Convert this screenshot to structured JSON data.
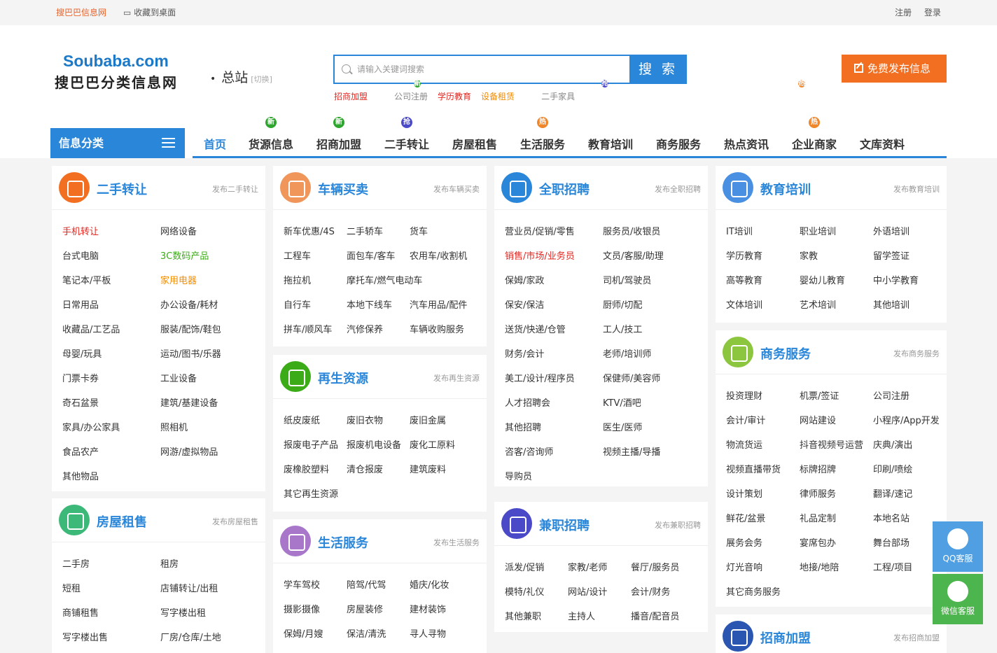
{
  "topbar": {
    "site": "搜巴巴信息网",
    "bookmark": "收藏到桌面",
    "register": "注册",
    "login": "登录"
  },
  "logo": {
    "en": "Soubaba.com",
    "cn": "搜巴巴分类信息网"
  },
  "station": {
    "name": "总站",
    "switch": "[切换]"
  },
  "search": {
    "placeholder": "请输入关键词搜索",
    "button": "搜 索"
  },
  "hotwords": [
    {
      "label": "招商加盟",
      "color": "#e3261f",
      "badge": "新",
      "badge_type": "new"
    },
    {
      "label": "公司注册",
      "color": "#888888",
      "badge": "",
      "badge_type": ""
    },
    {
      "label": "学历教育",
      "color": "#e3261f",
      "badge": "",
      "badge_type": ""
    },
    {
      "label": "设备租赁",
      "color": "#f28c00",
      "badge": "抢",
      "badge_type": "grab"
    },
    {
      "label": "二手家具",
      "color": "#888888",
      "badge": "热",
      "badge_type": "hot"
    }
  ],
  "publish": {
    "label": "免费发布信息"
  },
  "category_box": {
    "label": "信息分类"
  },
  "nav": [
    {
      "label": "首页",
      "active": true,
      "badge": "",
      "badge_type": ""
    },
    {
      "label": "货源信息",
      "active": false,
      "badge": "新",
      "badge_type": "new"
    },
    {
      "label": "招商加盟",
      "active": false,
      "badge": "新",
      "badge_type": "new"
    },
    {
      "label": "二手转让",
      "active": false,
      "badge": "抢",
      "badge_type": "grab"
    },
    {
      "label": "房屋租售",
      "active": false,
      "badge": "",
      "badge_type": ""
    },
    {
      "label": "生活服务",
      "active": false,
      "badge": "热",
      "badge_type": "hot"
    },
    {
      "label": "教育培训",
      "active": false,
      "badge": "",
      "badge_type": ""
    },
    {
      "label": "商务服务",
      "active": false,
      "badge": "",
      "badge_type": ""
    },
    {
      "label": "热点资讯",
      "active": false,
      "badge": "",
      "badge_type": ""
    },
    {
      "label": "企业商家",
      "active": false,
      "badge": "热",
      "badge_type": "hot"
    },
    {
      "label": "文库资料",
      "active": false,
      "badge": "",
      "badge_type": ""
    }
  ],
  "panels": [
    {
      "title": "二手转让",
      "publish": "发布二手转让",
      "icon_color": "#f26f21",
      "icon": "cart-icon",
      "items": [
        {
          "label": "手机转让",
          "style": "red"
        },
        {
          "label": "网络设备",
          "style": ""
        },
        {
          "label": "台式电脑",
          "style": ""
        },
        {
          "label": "3C数码产品",
          "style": "green"
        },
        {
          "label": "笔记本/平板",
          "style": ""
        },
        {
          "label": "家用电器",
          "style": "orange"
        },
        {
          "label": "日常用品",
          "style": ""
        },
        {
          "label": "办公设备/耗材",
          "style": ""
        },
        {
          "label": "收藏品/工艺品",
          "style": ""
        },
        {
          "label": "服装/配饰/鞋包",
          "style": ""
        },
        {
          "label": "母婴/玩具",
          "style": ""
        },
        {
          "label": "运动/图书/乐器",
          "style": ""
        },
        {
          "label": "门票卡券",
          "style": ""
        },
        {
          "label": "工业设备",
          "style": ""
        },
        {
          "label": "奇石盆景",
          "style": ""
        },
        {
          "label": "建筑/基建设备",
          "style": ""
        },
        {
          "label": "家具/办公家具",
          "style": ""
        },
        {
          "label": "照相机",
          "style": ""
        },
        {
          "label": "食品农产",
          "style": ""
        },
        {
          "label": "网游/虚拟物品",
          "style": ""
        },
        {
          "label": "其他物品",
          "style": ""
        }
      ]
    },
    {
      "title": "房屋租售",
      "publish": "发布房屋租售",
      "icon_color": "#3cb878",
      "icon": "house-icon",
      "items": [
        {
          "label": "二手房",
          "style": ""
        },
        {
          "label": "租房",
          "style": ""
        },
        {
          "label": "短租",
          "style": ""
        },
        {
          "label": "店铺转让/出租",
          "style": ""
        },
        {
          "label": "商铺租售",
          "style": ""
        },
        {
          "label": "写字楼出租",
          "style": ""
        },
        {
          "label": "写字楼出售",
          "style": ""
        },
        {
          "label": "厂房/仓库/土地",
          "style": ""
        }
      ]
    },
    {
      "title": "车辆买卖",
      "publish": "发布车辆买卖",
      "icon_color": "#f0965a",
      "icon": "car-icon",
      "items": [
        {
          "label": "新车优惠/4S",
          "style": ""
        },
        {
          "label": "二手轿车",
          "style": ""
        },
        {
          "label": "货车",
          "style": ""
        },
        {
          "label": "工程车",
          "style": ""
        },
        {
          "label": "面包车/客车",
          "style": ""
        },
        {
          "label": "农用车/收割机",
          "style": ""
        },
        {
          "label": "拖拉机",
          "style": ""
        },
        {
          "label": "摩托车/燃气电动车",
          "style": ""
        },
        {
          "label": "",
          "style": ""
        },
        {
          "label": "自行车",
          "style": ""
        },
        {
          "label": "本地下线车",
          "style": ""
        },
        {
          "label": "汽车用品/配件",
          "style": ""
        },
        {
          "label": "拼车/顺风车",
          "style": ""
        },
        {
          "label": "汽修保养",
          "style": ""
        },
        {
          "label": "车辆收购服务",
          "style": ""
        }
      ]
    },
    {
      "title": "再生资源",
      "publish": "发布再生资源",
      "icon_color": "#3cab18",
      "icon": "recycle-icon",
      "items": [
        {
          "label": "纸皮废纸",
          "style": ""
        },
        {
          "label": "废旧衣物",
          "style": ""
        },
        {
          "label": "废旧金属",
          "style": ""
        },
        {
          "label": "报废电子产品",
          "style": ""
        },
        {
          "label": "报废机电设备",
          "style": ""
        },
        {
          "label": "废化工原料",
          "style": ""
        },
        {
          "label": "废橡胶塑料",
          "style": ""
        },
        {
          "label": "清仓报废",
          "style": ""
        },
        {
          "label": "建筑废料",
          "style": ""
        },
        {
          "label": "其它再生资源",
          "style": ""
        }
      ]
    },
    {
      "title": "生活服务",
      "publish": "发布生活服务",
      "icon_color": "#a877c9",
      "icon": "umbrella-icon",
      "items": [
        {
          "label": "学车驾校",
          "style": ""
        },
        {
          "label": "陪驾/代驾",
          "style": ""
        },
        {
          "label": "婚庆/化妆",
          "style": ""
        },
        {
          "label": "摄影摄像",
          "style": ""
        },
        {
          "label": "房屋装修",
          "style": ""
        },
        {
          "label": "建材装饰",
          "style": ""
        },
        {
          "label": "保姆/月嫂",
          "style": ""
        },
        {
          "label": "保洁/清洗",
          "style": ""
        },
        {
          "label": "寻人寻物",
          "style": ""
        }
      ]
    },
    {
      "title": "全职招聘",
      "publish": "发布全职招聘",
      "icon_color": "#2a86d9",
      "icon": "magnifier-icon",
      "items": [
        {
          "label": "营业员/促销/零售",
          "style": ""
        },
        {
          "label": "服务员/收银员",
          "style": ""
        },
        {
          "label": "销售/市场/业务员",
          "style": "red"
        },
        {
          "label": "文员/客服/助理",
          "style": ""
        },
        {
          "label": "保姆/家政",
          "style": ""
        },
        {
          "label": "司机/驾驶员",
          "style": ""
        },
        {
          "label": "保安/保洁",
          "style": ""
        },
        {
          "label": "厨师/切配",
          "style": ""
        },
        {
          "label": "送货/快递/仓管",
          "style": ""
        },
        {
          "label": "工人/技工",
          "style": ""
        },
        {
          "label": "财务/会计",
          "style": ""
        },
        {
          "label": "老师/培训师",
          "style": ""
        },
        {
          "label": "美工/设计/程序员",
          "style": ""
        },
        {
          "label": "保健师/美容师",
          "style": ""
        },
        {
          "label": "人才招聘会",
          "style": ""
        },
        {
          "label": "KTV/酒吧",
          "style": ""
        },
        {
          "label": "其他招聘",
          "style": ""
        },
        {
          "label": "医生/医师",
          "style": ""
        },
        {
          "label": "咨客/咨询师",
          "style": ""
        },
        {
          "label": "视频主播/导播",
          "style": ""
        },
        {
          "label": "导购员",
          "style": ""
        }
      ]
    },
    {
      "title": "兼职招聘",
      "publish": "发布兼职招聘",
      "icon_color": "#4a4ac8",
      "icon": "clock-icon",
      "items": [
        {
          "label": "派发/促销",
          "style": ""
        },
        {
          "label": "家教/老师",
          "style": ""
        },
        {
          "label": "餐厅/服务员",
          "style": ""
        },
        {
          "label": "模特/礼仪",
          "style": ""
        },
        {
          "label": "网站/设计",
          "style": ""
        },
        {
          "label": "会计/财务",
          "style": ""
        },
        {
          "label": "其他兼职",
          "style": ""
        },
        {
          "label": "主持人",
          "style": ""
        },
        {
          "label": "播音/配音员",
          "style": ""
        }
      ]
    },
    {
      "title": "教育培训",
      "publish": "发布教育培训",
      "icon_color": "#4a90e2",
      "icon": "graduation-icon",
      "items": [
        {
          "label": "IT培训",
          "style": ""
        },
        {
          "label": "职业培训",
          "style": ""
        },
        {
          "label": "外语培训",
          "style": ""
        },
        {
          "label": "学历教育",
          "style": ""
        },
        {
          "label": "家教",
          "style": ""
        },
        {
          "label": "留学签证",
          "style": ""
        },
        {
          "label": "高等教育",
          "style": ""
        },
        {
          "label": "婴幼儿教育",
          "style": ""
        },
        {
          "label": "中小学教育",
          "style": ""
        },
        {
          "label": "文体培训",
          "style": ""
        },
        {
          "label": "艺术培训",
          "style": ""
        },
        {
          "label": "其他培训",
          "style": ""
        }
      ]
    },
    {
      "title": "商务服务",
      "publish": "发布商务服务",
      "icon_color": "#8cc63f",
      "icon": "phone-icon",
      "items": [
        {
          "label": "投资理财",
          "style": ""
        },
        {
          "label": "机票/签证",
          "style": ""
        },
        {
          "label": "公司注册",
          "style": ""
        },
        {
          "label": "会计/审计",
          "style": ""
        },
        {
          "label": "网站建设",
          "style": ""
        },
        {
          "label": "小程序/App开发",
          "style": ""
        },
        {
          "label": "物流货运",
          "style": ""
        },
        {
          "label": "抖音视频号运营",
          "style": ""
        },
        {
          "label": "庆典/演出",
          "style": ""
        },
        {
          "label": "视频直播带货",
          "style": ""
        },
        {
          "label": "标牌招牌",
          "style": ""
        },
        {
          "label": "印刷/喷绘",
          "style": ""
        },
        {
          "label": "设计策划",
          "style": ""
        },
        {
          "label": "律师服务",
          "style": ""
        },
        {
          "label": "翻译/速记",
          "style": ""
        },
        {
          "label": "鲜花/盆景",
          "style": ""
        },
        {
          "label": "礼品定制",
          "style": ""
        },
        {
          "label": "本地名站",
          "style": ""
        },
        {
          "label": "展务会务",
          "style": ""
        },
        {
          "label": "宴席包办",
          "style": ""
        },
        {
          "label": "舞台部场",
          "style": ""
        },
        {
          "label": "灯光音响",
          "style": ""
        },
        {
          "label": "地接/地陪",
          "style": ""
        },
        {
          "label": "工程/项目",
          "style": ""
        },
        {
          "label": "其它商务服务",
          "style": ""
        }
      ]
    },
    {
      "title": "招商加盟",
      "publish": "发布招商加盟",
      "icon_color": "#2a55b0",
      "icon": "handshake-icon",
      "items": []
    }
  ],
  "side": {
    "qq": "QQ客服",
    "wechat": "微信客服"
  }
}
